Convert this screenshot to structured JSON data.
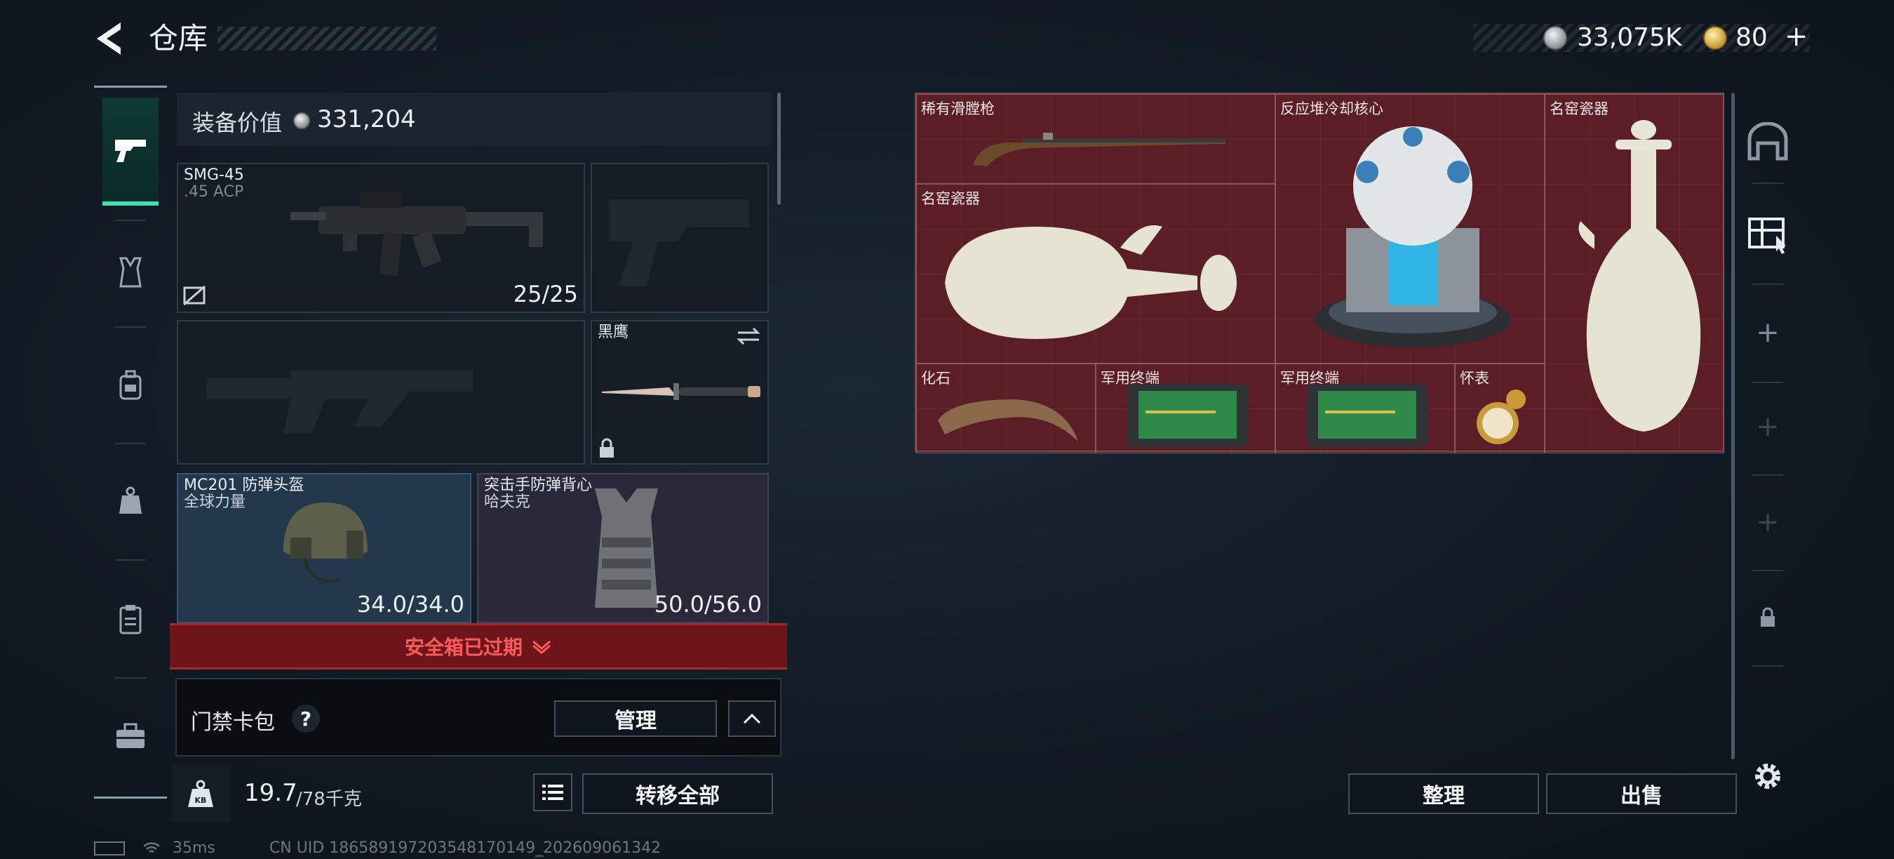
{
  "header": {
    "title": "仓库",
    "currency": {
      "silver": "33,075K",
      "gold": "80"
    }
  },
  "left_nav": {
    "items": [
      "weapons",
      "vest",
      "backpack",
      "case",
      "clipboard",
      "toolbox"
    ],
    "active": "weapons"
  },
  "equipment": {
    "value_label": "装备价值",
    "value": "331,204",
    "primary_weapon": {
      "name": "SMG-45",
      "ammo": ".45 ACP",
      "count": "25/25"
    },
    "melee": {
      "name": "黑鹰"
    },
    "helmet": {
      "name": "MC201 防弹头盔",
      "brand": "全球力量",
      "durability": "34.0/34.0"
    },
    "armor": {
      "name": "突击手防弹背心",
      "brand": "哈夫克",
      "durability": "50.0/56.0"
    }
  },
  "safe_box": {
    "status": "安全箱已过期"
  },
  "card_pack": {
    "label": "门禁卡包",
    "help": "?",
    "manage_label": "管理"
  },
  "weight": {
    "current": "19.7",
    "max": "/78千克",
    "kb_label": "KB"
  },
  "transfer_all_label": "转移全部",
  "stash": {
    "items": [
      {
        "label": "稀有滑膛枪"
      },
      {
        "label": "反应堆冷却核心"
      },
      {
        "label": "名窑瓷器"
      },
      {
        "label": "名窑瓷器"
      },
      {
        "label": "化石"
      },
      {
        "label": "军用终端"
      },
      {
        "label": "军用终端"
      },
      {
        "label": "怀表"
      }
    ]
  },
  "actions": {
    "sort_label": "整理",
    "sell_label": "出售"
  },
  "status": {
    "latency": "35ms",
    "uid": "CN UID 18658919720354817014​9_202609061342"
  }
}
